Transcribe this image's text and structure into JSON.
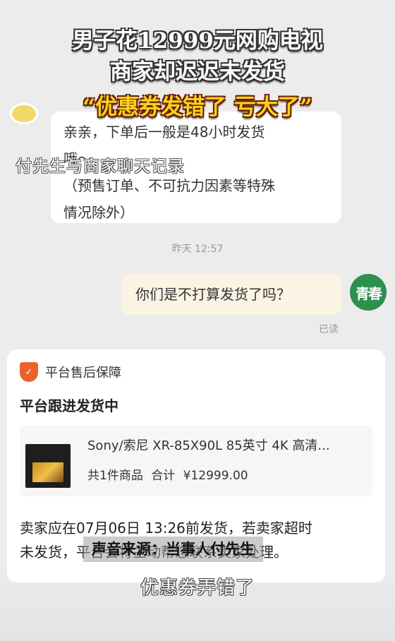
{
  "headline": {
    "line1": "男子花12999元网购电视",
    "line2": "商家却迟迟未发货",
    "quote": "“优惠券发错了 亏大了”"
  },
  "overlay_caption": "付先生与商家聊天记录",
  "chat": {
    "merchant_message_lines": [
      "亲亲，下单后一般是48小时发货",
      "哦～",
      "（预售订单、不可抗力因素等特殊",
      "情况除外）"
    ],
    "timestamp": "昨天 12:57",
    "user_message": "你们是不打算发货了吗？",
    "user_avatar_text": "青春",
    "read_status": "已读"
  },
  "service_card": {
    "header_label": "平台售后保障",
    "title": "平台跟进发货中",
    "product": {
      "name": "Sony/索尼 XR-85X90L 85英寸 4K 高清...",
      "count": "共1件商品",
      "total_label": "合计",
      "total_price": "¥12999.00"
    },
    "notice_lines": [
      "卖家应在07月06日 13:26前发货，若卖家超时",
      "未发货，平台会将主动帮您联系卖家处理。"
    ]
  },
  "source_label": "声音来源：当事人付先生",
  "subtitle": "优惠券弄错了",
  "colors": {
    "background": "#ececec",
    "user_bubble": "#fbf3e4",
    "accent_orange": "#e9622b",
    "quote_yellow": "#f7d21a",
    "avatar_green": "#2f8f4e"
  }
}
